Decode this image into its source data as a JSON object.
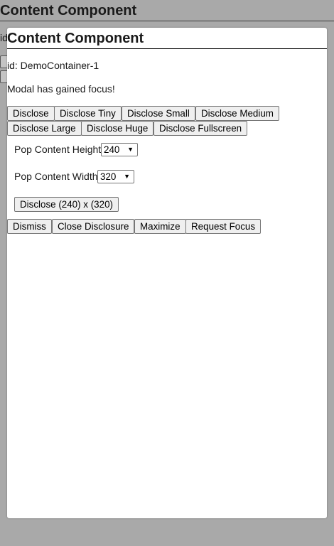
{
  "background": {
    "title": "Content Component",
    "id_label": "id"
  },
  "modal": {
    "title": "Content Component",
    "id_text": "id: DemoContainer-1",
    "focus_message": "Modal has gained focus!",
    "disclose_buttons": [
      "Disclose",
      "Disclose Tiny",
      "Disclose Small",
      "Disclose Medium",
      "Disclose Large",
      "Disclose Huge",
      "Disclose Fullscreen"
    ],
    "height_label": "Pop Content Height",
    "height_value": "240",
    "width_label": "Pop Content Width",
    "width_value": "320",
    "custom_disclose_label": "Disclose (240) x (320)",
    "action_buttons": [
      "Dismiss",
      "Close Disclosure",
      "Maximize",
      "Request Focus"
    ]
  }
}
